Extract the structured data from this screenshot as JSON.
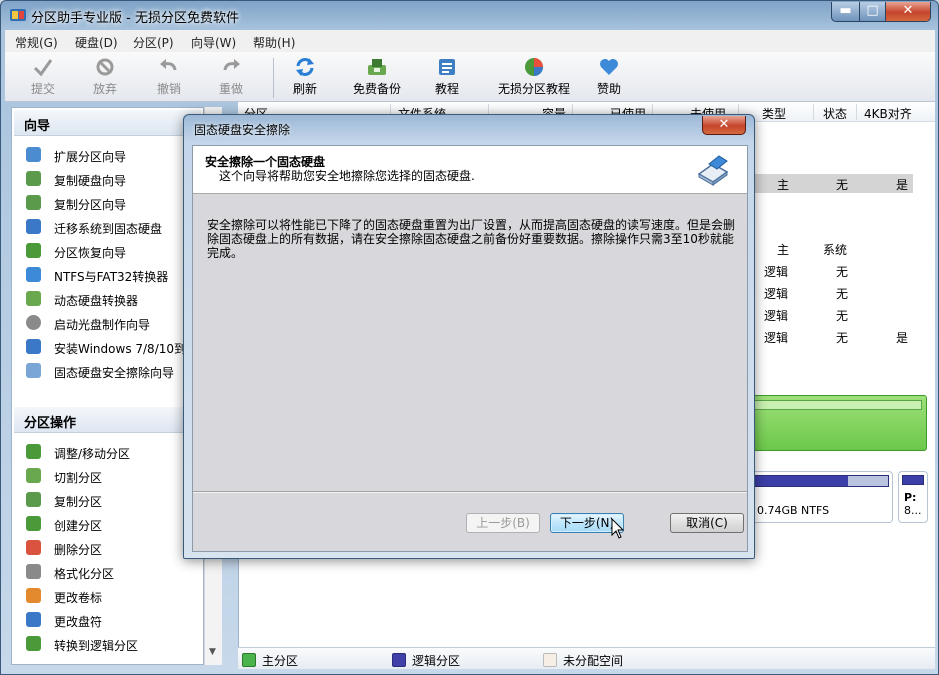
{
  "window": {
    "title": "分区助手专业版 - 无损分区免费软件",
    "min": "▬",
    "max": "□",
    "close": "✕"
  },
  "menubar": [
    "常规(G)",
    "硬盘(D)",
    "分区(P)",
    "向导(W)",
    "帮助(H)"
  ],
  "toolbar": [
    {
      "label": "提交",
      "icon": "check-icon",
      "disabled": true
    },
    {
      "label": "放弃",
      "icon": "discard-icon",
      "disabled": true
    },
    {
      "label": "撤销",
      "icon": "undo-icon",
      "disabled": true
    },
    {
      "label": "重做",
      "icon": "redo-icon",
      "disabled": true
    },
    {
      "label": "刷新",
      "icon": "refresh-icon",
      "disabled": false
    },
    {
      "label": "免费备份",
      "icon": "backup-icon",
      "disabled": false
    },
    {
      "label": "教程",
      "icon": "tutorial-icon",
      "disabled": false
    },
    {
      "label": "无损分区教程",
      "icon": "partition-tutorial-icon",
      "disabled": false
    },
    {
      "label": "赞助",
      "icon": "heart-icon",
      "disabled": false
    }
  ],
  "wizard_section": {
    "title": "向导",
    "items": [
      "扩展分区向导",
      "复制硬盘向导",
      "复制分区向导",
      "迁移系统到固态硬盘",
      "分区恢复向导",
      "NTFS与FAT32转换器",
      "动态硬盘转换器",
      "启动光盘制作向导",
      "安装Windows 7/8/10到...",
      "固态硬盘安全擦除向导"
    ]
  },
  "partition_ops": {
    "title": "分区操作",
    "items": [
      "调整/移动分区",
      "切割分区",
      "复制分区",
      "创建分区",
      "删除分区",
      "格式化分区",
      "更改卷标",
      "更改盘符",
      "转换到逻辑分区"
    ]
  },
  "columns": [
    "分区",
    "文件系统",
    "容量",
    "已使用",
    "未使用",
    "类型",
    "状态",
    "4KB对齐"
  ],
  "rows_visible": [
    {
      "type": "主",
      "status": "无",
      "align": "是"
    },
    {
      "type": "主",
      "status": "系统",
      "align": ""
    },
    {
      "type": "逻辑",
      "status": "无",
      "align": ""
    },
    {
      "type": "逻辑",
      "status": "无",
      "align": ""
    },
    {
      "type": "逻辑",
      "status": "无",
      "align": ""
    },
    {
      "type": "逻辑",
      "status": "无",
      "align": "是"
    }
  ],
  "disk_map": {
    "partition_label": "0.74GB NTFS",
    "small_label": "P:",
    "small_sub": "8..."
  },
  "legend": [
    "主分区",
    "逻辑分区",
    "未分配空间"
  ],
  "colors": {
    "primary": "#4bb34b",
    "logical": "#4040a8",
    "unallocated": "#f6efe6"
  },
  "dialog": {
    "title": "固态硬盘安全擦除",
    "close": "✕",
    "header_title": "安全擦除一个固态硬盘",
    "header_subtitle": "这个向导将帮助您安全地擦除您选择的固态硬盘.",
    "description": "安全擦除可以将性能已下降了的固态硬盘重置为出厂设置，从而提高固态硬盘的读写速度。但是会删除固态硬盘上的所有数据，请在安全擦除固态硬盘之前备份好重要数据。擦除操作只需3至10秒就能 完成。",
    "prev": "上一步(B)",
    "next": "下一步(N)",
    "cancel": "取消(C)"
  }
}
